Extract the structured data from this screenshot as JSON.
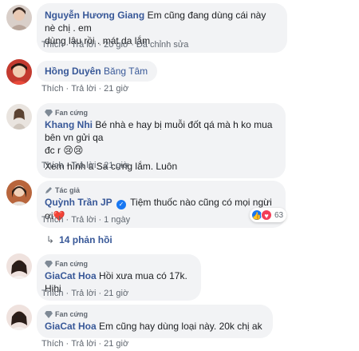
{
  "ui": {
    "like_label": "Thích",
    "reply_label": "Trả lời",
    "separator": "·",
    "fan_badge": "Fan cứng",
    "author_badge": "Tác giả"
  },
  "comments": [
    {
      "name": "Nguyễn Hương Giang",
      "text_line1": "Em cũng đang dùng cái này nè chị . em",
      "text_line2": "dùng lâu rồi . mát da lắm",
      "time": "20 giờ",
      "edited": "Đã chỉnh sửa"
    },
    {
      "name": "Hồng Duyên",
      "text": "Băng Tâm",
      "time": "21 giờ"
    },
    {
      "name": "Khang Nhi",
      "text_line1": "Bé nhà e hay bị muỗi đốt qá mà h ko mua bên vn gửi qa",
      "text_line2": "đc r 😢😢",
      "text_line3": "Xem hình a Sa cưng lắm. Luôn",
      "time": "21 giờ"
    },
    {
      "name": "Quỳnh Trần JP",
      "verified": "✓",
      "text": "Tiệm thuốc nào cũng có mọi ngừi ơi❤️",
      "time": "1 ngày",
      "reaction_count": "63",
      "replies": "14 phản hồi"
    },
    {
      "name": "GiaCat Hoa",
      "text": "Hồi xưa mua có 17k. Hihi",
      "time": "21 giờ"
    },
    {
      "name": "GiaCat Hoa",
      "text": "Em cũng hay dùng loại này. 20k chị ak",
      "time": "21 giờ"
    }
  ],
  "colors": {
    "name": "#385898",
    "bubble": "#f2f3f5",
    "meta": "#606770",
    "like": "#1877f2",
    "love": "#f33e58"
  }
}
